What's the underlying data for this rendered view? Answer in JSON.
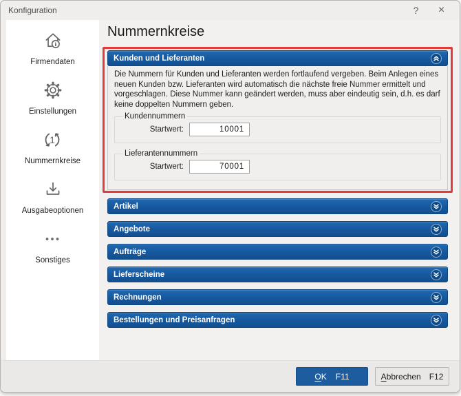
{
  "window": {
    "title": "Konfiguration",
    "help": "?",
    "close": "×"
  },
  "sidebar": {
    "active": "Nummernkreise",
    "items": [
      {
        "icon": "home-info-icon",
        "label": "Firmendaten"
      },
      {
        "icon": "gear-icon",
        "label": "Einstellungen"
      },
      {
        "icon": "number-cycle-icon",
        "label": "Nummernkreise"
      },
      {
        "icon": "output-tray-icon",
        "label": "Ausgabeoptionen"
      },
      {
        "icon": "ellipsis-icon",
        "label": "Sonstiges"
      }
    ]
  },
  "main": {
    "title": "Nummernkreise"
  },
  "sections": {
    "expanded": {
      "title": "Kunden und Lieferanten",
      "description": "Die Nummern für Kunden und Lieferanten werden fortlaufend vergeben. Beim Anlegen eines neuen Kunden bzw. Lieferanten wird automatisch die nächste freie Nummer ermittelt und vorgeschlagen. Diese Nummer kann geändert werden, muss aber eindeutig sein, d.h. es darf keine doppelten Nummern geben.",
      "groups": [
        {
          "legend": "Kundennummern",
          "label": "Startwert:",
          "value": "10001"
        },
        {
          "legend": "Lieferantennummern",
          "label": "Startwert:",
          "value": "70001"
        }
      ]
    },
    "collapsed": [
      "Artikel",
      "Angebote",
      "Aufträge",
      "Lieferscheine",
      "Rechnungen",
      "Bestellungen und Preisanfragen"
    ]
  },
  "footer": {
    "ok_mnemonic": "O",
    "ok_rest": "K",
    "ok_shortcut": "F11",
    "cancel_mnemonic": "A",
    "cancel_rest": "bbrechen",
    "cancel_shortcut": "F12"
  },
  "colors": {
    "accent_blue": "#15599e",
    "annotation_red": "#e23b3b"
  }
}
